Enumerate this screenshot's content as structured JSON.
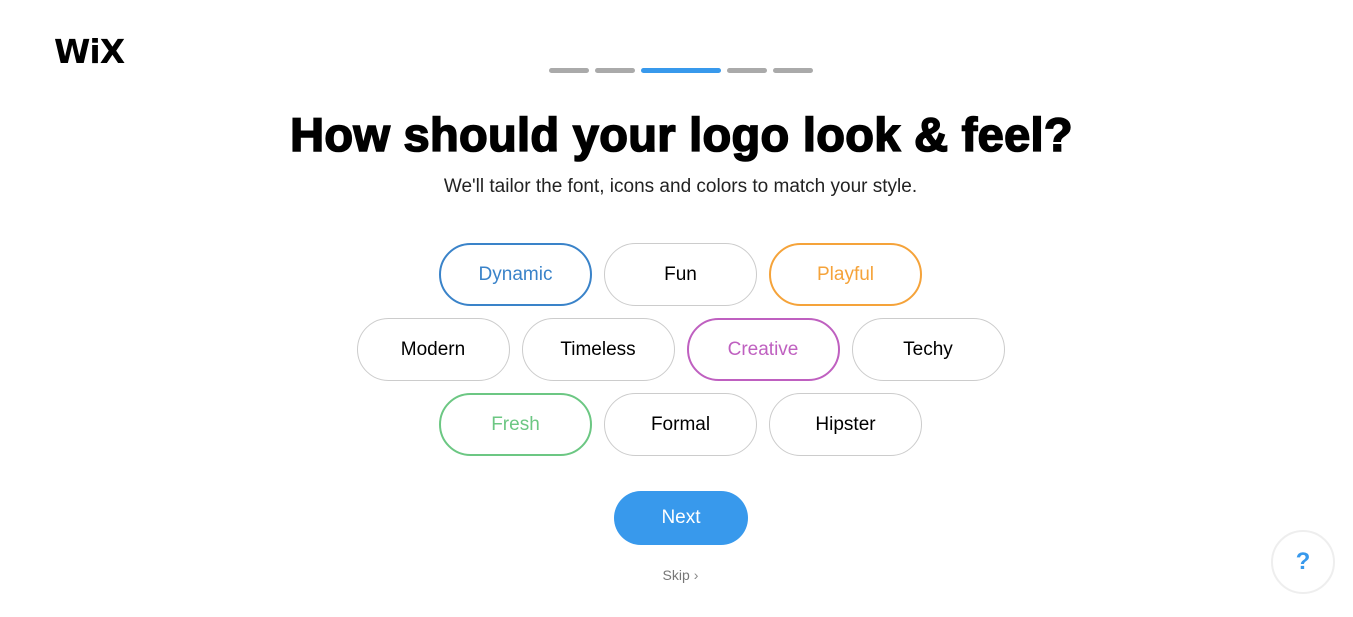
{
  "brand": {
    "logo_text": "WiX"
  },
  "progress": {
    "total_steps": 5,
    "current_step": 3,
    "active_color": "#3899ec",
    "inactive_color": "#aaaaaa"
  },
  "header": {
    "title": "How should your logo look & feel?",
    "subtitle": "We'll tailor the font, icons and colors to match your style."
  },
  "styles": {
    "rows": [
      [
        {
          "label": "Dynamic",
          "selected": true,
          "color": "#3a83c9"
        },
        {
          "label": "Fun",
          "selected": false
        },
        {
          "label": "Playful",
          "selected": true,
          "color": "#f5a33a"
        }
      ],
      [
        {
          "label": "Modern",
          "selected": false
        },
        {
          "label": "Timeless",
          "selected": false
        },
        {
          "label": "Creative",
          "selected": true,
          "color": "#bf60c0"
        },
        {
          "label": "Techy",
          "selected": false
        }
      ],
      [
        {
          "label": "Fresh",
          "selected": true,
          "color": "#6cc783"
        },
        {
          "label": "Formal",
          "selected": false
        },
        {
          "label": "Hipster",
          "selected": false
        }
      ]
    ]
  },
  "actions": {
    "next_label": "Next",
    "skip_label": "Skip",
    "skip_icon": "chevron-right-icon",
    "help_label": "?",
    "help_icon": "question-mark-icon"
  }
}
